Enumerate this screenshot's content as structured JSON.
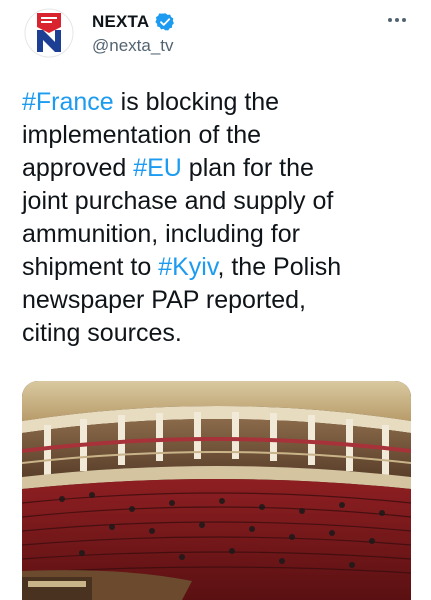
{
  "author": {
    "display_name": "NEXTA",
    "handle": "@nexta_tv",
    "verified": true,
    "avatar_letter": "N",
    "brand_red": "#d9232e",
    "brand_blue": "#1c3f94"
  },
  "more_icon": "more-horizontal-icon",
  "tweet": {
    "lines": [
      [
        {
          "t": "#France",
          "tag": true
        },
        {
          "t": " is blocking the",
          "tag": false
        }
      ],
      [
        {
          "t": "implementation of the",
          "tag": false
        }
      ],
      [
        {
          "t": "approved ",
          "tag": false
        },
        {
          "t": "#EU",
          "tag": true
        },
        {
          "t": " plan for the",
          "tag": false
        }
      ],
      [
        {
          "t": "joint purchase and supply of",
          "tag": false
        }
      ],
      [
        {
          "t": "ammunition, including for",
          "tag": false
        }
      ],
      [
        {
          "t": "shipment to ",
          "tag": false
        },
        {
          "t": "#Kyiv",
          "tag": true
        },
        {
          "t": ", the Polish",
          "tag": false
        }
      ],
      [
        {
          "t": "newspaper PAP reported,",
          "tag": false
        }
      ],
      [
        {
          "t": "citing sources.",
          "tag": false
        }
      ]
    ]
  },
  "media": {
    "subject": "parliament-chamber-photo"
  },
  "colors": {
    "link": "#1d9bf0",
    "text": "#0f1419",
    "secondary": "#536471"
  }
}
